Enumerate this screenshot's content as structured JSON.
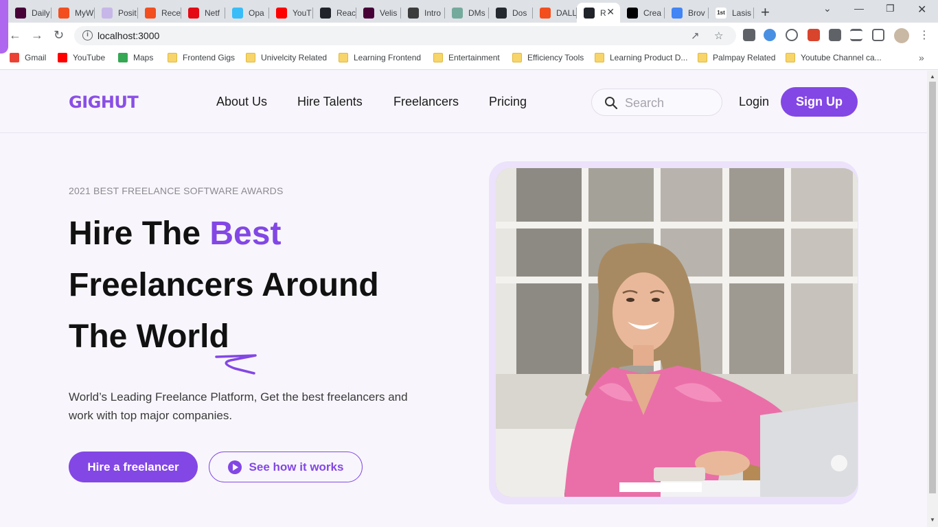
{
  "browser": {
    "tabs": [
      {
        "title": "Daily",
        "favicon": "xd-icon",
        "color": "#470137"
      },
      {
        "title": "MyW",
        "favicon": "figma-icon",
        "color": "#f24e1e"
      },
      {
        "title": "Posit",
        "favicon": "page-icon",
        "color": "#c6b7e8"
      },
      {
        "title": "Rece",
        "favicon": "figma-icon",
        "color": "#f24e1e"
      },
      {
        "title": "Netf",
        "favicon": "netflix-icon",
        "color": "#e50914"
      },
      {
        "title": "Opa",
        "favicon": "tailwind-icon",
        "color": "#38bdf8"
      },
      {
        "title": "YouT",
        "favicon": "youtube-icon",
        "color": "#ff0000"
      },
      {
        "title": "Reac",
        "favicon": "react-icon",
        "color": "#20232a"
      },
      {
        "title": "Velis",
        "favicon": "xd-icon",
        "color": "#470137"
      },
      {
        "title": "Intro",
        "favicon": "openai-icon",
        "color": "#3c3c3c"
      },
      {
        "title": "DMs",
        "favicon": "openai-icon",
        "color": "#74aa9c"
      },
      {
        "title": "Dos",
        "favicon": "github-icon",
        "color": "#24292f"
      },
      {
        "title": "DALL",
        "favicon": "figma-icon",
        "color": "#f24e1e"
      },
      {
        "title": "R",
        "favicon": "react-icon",
        "color": "#20232a",
        "active": true
      },
      {
        "title": "Crea",
        "favicon": "triangle-icon",
        "color": "#000000"
      },
      {
        "title": "Brov",
        "favicon": "colorful-icon",
        "color": "#4285f4"
      },
      {
        "title": "Lasis",
        "favicon": "1st-icon",
        "color": "#ffffff"
      }
    ],
    "url": "localhost:3000",
    "bookmarks": [
      {
        "label": "Gmail",
        "icon": "gmail-icon"
      },
      {
        "label": "YouTube",
        "icon": "youtube-icon"
      },
      {
        "label": "Maps",
        "icon": "maps-icon"
      },
      {
        "label": "Frontend Gigs",
        "icon": "folder-icon"
      },
      {
        "label": "Univelcity Related",
        "icon": "folder-icon"
      },
      {
        "label": "Learning Frontend",
        "icon": "folder-icon"
      },
      {
        "label": "Entertainment",
        "icon": "folder-icon"
      },
      {
        "label": "Efficiency Tools",
        "icon": "folder-icon"
      },
      {
        "label": "Learning Product D...",
        "icon": "folder-icon"
      },
      {
        "label": "Palmpay Related",
        "icon": "folder-icon"
      },
      {
        "label": "Youtube Channel ca...",
        "icon": "folder-icon"
      }
    ]
  },
  "site": {
    "logo": "GIGHUT",
    "nav": {
      "about": "About Us",
      "hire": "Hire Talents",
      "freelancers": "Freelancers",
      "pricing": "Pricing"
    },
    "search_placeholder": "Search",
    "login": "Login",
    "signup": "Sign Up",
    "accent_color": "#8347e5"
  },
  "hero": {
    "eyebrow": "2021 BEST FREELANCE SOFTWARE AWARDS",
    "headline_part1": "Hire The ",
    "headline_accent": "Best",
    "headline_part2": "Freelancers Around",
    "headline_part3": "The World",
    "subtext": "World’s Leading Freelance Platform, Get the best freelancers and work with top major companies.",
    "primary_cta": "Hire a freelancer",
    "secondary_cta": "See how it works"
  }
}
